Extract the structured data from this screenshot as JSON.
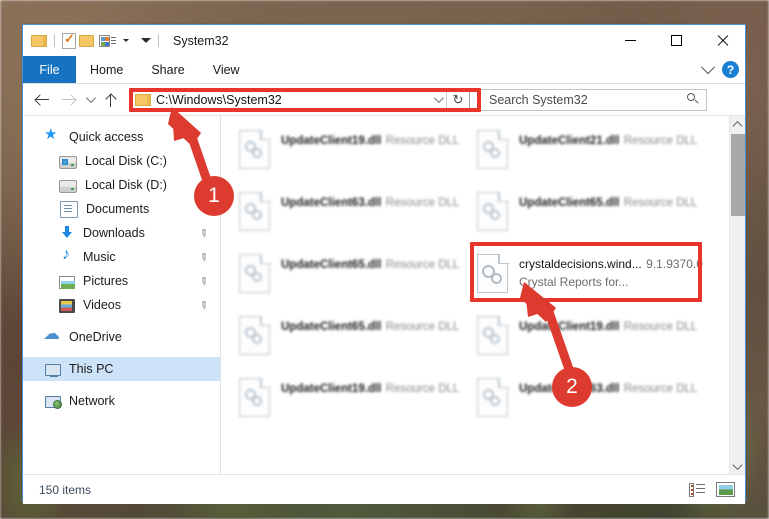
{
  "window": {
    "title": "System32",
    "quick_access_icons": [
      "folder-icon",
      "properties-icon",
      "new-folder-icon",
      "customize-toolbar-icon",
      "dropdown-caret-icon"
    ],
    "controls": {
      "minimize": "minimize-icon",
      "maximize": "maximize-icon",
      "close": "close-icon"
    }
  },
  "ribbon": {
    "tabs": [
      {
        "label": "File",
        "active": true
      },
      {
        "label": "Home",
        "active": false
      },
      {
        "label": "Share",
        "active": false
      },
      {
        "label": "View",
        "active": false
      }
    ],
    "collapse_icon": "chevron-down-icon",
    "help_label": "?"
  },
  "nav": {
    "back_icon": "arrow-left-icon",
    "forward_icon": "arrow-right-icon",
    "recent_icon": "chevron-down-icon",
    "up_icon": "arrow-up-icon",
    "address": {
      "folder_icon": "folder-icon",
      "path": "C:\\Windows\\System32",
      "dropdown_icon": "chevron-down-icon",
      "refresh_icon": "refresh-icon",
      "refresh_glyph": "↻"
    },
    "search": {
      "placeholder": "Search System32",
      "value": "",
      "icon": "search-icon"
    }
  },
  "sidebar": {
    "items": [
      {
        "label": "Quick access",
        "icon": "star-icon",
        "indent": false,
        "pinned": false,
        "selected": false
      },
      {
        "label": "Local Disk (C:)",
        "icon": "drive-windows-icon",
        "indent": true,
        "pinned": false,
        "selected": false
      },
      {
        "label": "Local Disk (D:)",
        "icon": "drive-icon",
        "indent": true,
        "pinned": false,
        "selected": false
      },
      {
        "label": "Documents",
        "icon": "documents-icon",
        "indent": true,
        "pinned": false,
        "selected": false
      },
      {
        "label": "Downloads",
        "icon": "downloads-icon",
        "indent": true,
        "pinned": true,
        "selected": false
      },
      {
        "label": "Music",
        "icon": "music-icon",
        "indent": true,
        "pinned": true,
        "selected": false
      },
      {
        "label": "Pictures",
        "icon": "pictures-icon",
        "indent": true,
        "pinned": true,
        "selected": false
      },
      {
        "label": "Videos",
        "icon": "videos-icon",
        "indent": true,
        "pinned": true,
        "selected": false
      },
      {
        "label": "OneDrive",
        "icon": "cloud-icon",
        "indent": false,
        "pinned": false,
        "selected": false
      },
      {
        "label": "This PC",
        "icon": "computer-icon",
        "indent": false,
        "pinned": false,
        "selected": true
      },
      {
        "label": "Network",
        "icon": "network-icon",
        "indent": false,
        "pinned": false,
        "selected": false
      }
    ],
    "pin_glyph": "📌"
  },
  "files": [
    {
      "name": "UpdateClient19.dll",
      "line2": "Resource DLL",
      "line3": "",
      "icon": "dll-key-icon",
      "blurred": true,
      "selected": false
    },
    {
      "name": "UpdateClient21.dll",
      "line2": "Resource DLL",
      "line3": "",
      "icon": "dll-key-icon",
      "blurred": true,
      "selected": false
    },
    {
      "name": "UpdateClient63.dll",
      "line2": "Resource DLL",
      "line3": "",
      "icon": "dll-key-icon",
      "blurred": true,
      "selected": false
    },
    {
      "name": "UpdateClient65.dll",
      "line2": "Resource DLL",
      "line3": "",
      "icon": "dll-key-icon",
      "blurred": true,
      "selected": false
    },
    {
      "name": "UpdateClient65.dll",
      "line2": "Resource DLL",
      "line3": "",
      "icon": "dll-key-icon",
      "blurred": true,
      "selected": false
    },
    {
      "name": "crystaldecisions.wind...",
      "line2": "9.1.9370.0",
      "line3": "Crystal Reports for...",
      "icon": "dll-gear-icon",
      "blurred": false,
      "selected": true
    },
    {
      "name": "UpdateClient65.dll",
      "line2": "Resource DLL",
      "line3": "",
      "icon": "dll-key-icon",
      "blurred": true,
      "selected": false
    },
    {
      "name": "UpdateClient19.dll",
      "line2": "Resource DLL",
      "line3": "",
      "icon": "dll-key-icon",
      "blurred": true,
      "selected": false
    },
    {
      "name": "UpdateClient19.dll",
      "line2": "Resource DLL",
      "line3": "",
      "icon": "dll-key-icon",
      "blurred": true,
      "selected": false
    },
    {
      "name": "UpdateClient63.dll",
      "line2": "Resource DLL",
      "line3": "",
      "icon": "dll-key-icon",
      "blurred": true,
      "selected": false
    }
  ],
  "scrollbar": {
    "up_icon": "scroll-up-icon",
    "down_icon": "scroll-down-icon",
    "thumb": "scroll-thumb"
  },
  "status": {
    "item_count": "150 items",
    "view_details_icon": "details-view-icon",
    "view_thumbnails_icon": "thumbnails-view-icon"
  },
  "annotations": {
    "accent_color": "#dd3b30",
    "rect_color": "#e8342a",
    "markers": [
      {
        "label": "1",
        "target": "address-bar"
      },
      {
        "label": "2",
        "target": "crystaldecisions-file"
      }
    ]
  }
}
